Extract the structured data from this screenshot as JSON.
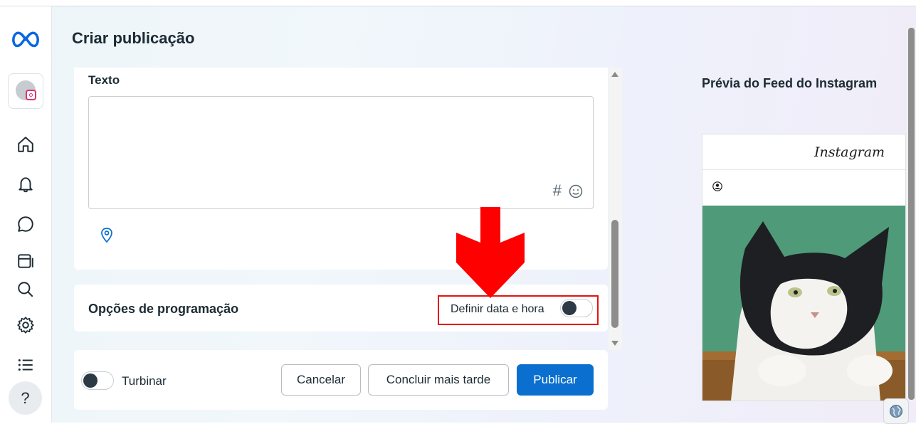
{
  "page": {
    "title": "Criar publicação"
  },
  "sidebar": {
    "items": [
      {
        "icon": "meta-logo-icon"
      },
      {
        "icon": "account-avatar"
      },
      {
        "icon": "home-icon"
      },
      {
        "icon": "bell-icon"
      },
      {
        "icon": "chat-icon"
      },
      {
        "icon": "media-library-icon"
      },
      {
        "icon": "search-icon"
      },
      {
        "icon": "gear-icon"
      },
      {
        "icon": "list-icon"
      },
      {
        "icon": "help-icon",
        "label": "?"
      }
    ]
  },
  "composer": {
    "text_label": "Texto",
    "text_value": "",
    "hashtag_symbol": "#"
  },
  "schedule": {
    "label": "Opções de programação",
    "toggle_label": "Definir data e hora",
    "toggle_on": false
  },
  "footer": {
    "boost_label": "Turbinar",
    "boost_on": false,
    "cancel_label": "Cancelar",
    "later_label": "Concluir mais tarde",
    "publish_label": "Publicar"
  },
  "preview": {
    "title": "Prévia do Feed do Instagram",
    "logo_text": "Instagram"
  },
  "colors": {
    "accent": "#0a6fce",
    "annotation_red": "#e3140f",
    "meta_blue": "#0668e1"
  }
}
